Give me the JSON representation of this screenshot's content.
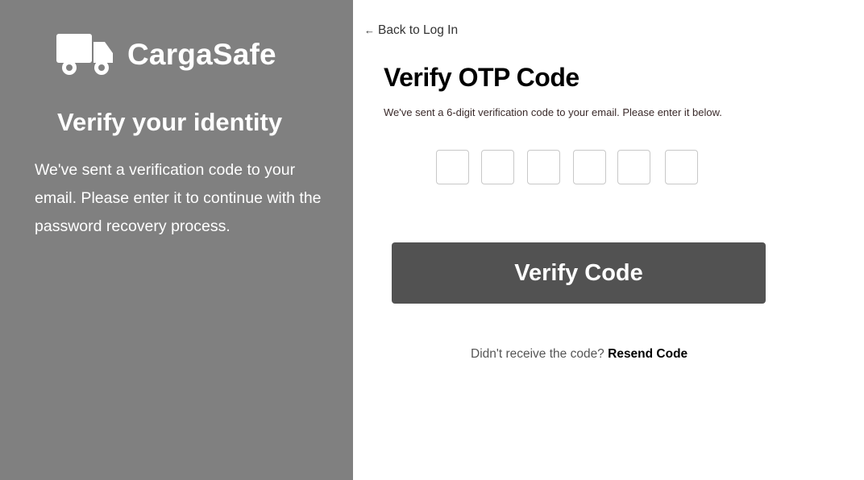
{
  "brand": {
    "name": "CargaSafe",
    "icon": "truck-icon"
  },
  "left_panel": {
    "title": "Verify your identity",
    "description": "We've sent a verification code to your email. Please enter it to continue with the password recovery process.",
    "background": "#808080"
  },
  "back_link": {
    "arrow": "←",
    "label": "Back to Log In"
  },
  "form": {
    "title": "Verify OTP Code",
    "subtitle": "We've sent a 6-digit verification code to your email. Please enter it below.",
    "otp_digits": [
      "",
      "",
      "",
      "",
      "",
      ""
    ],
    "submit_label": "Verify Code",
    "submit_color": "#525252"
  },
  "resend": {
    "prompt": "Didn't receive the code?",
    "link_label": "Resend Code"
  }
}
